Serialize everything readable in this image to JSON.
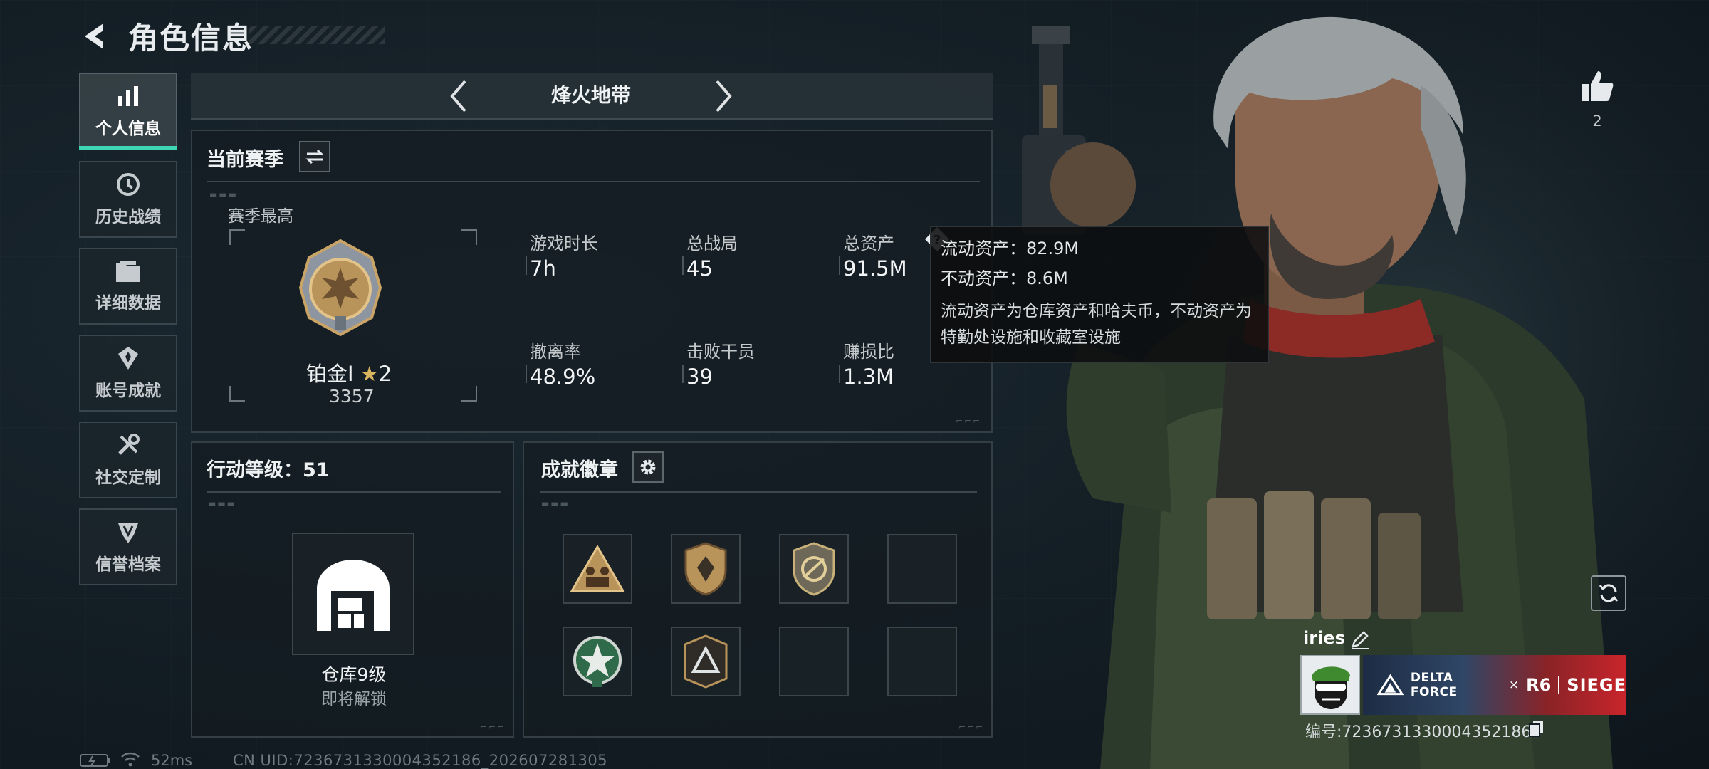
{
  "header": {
    "title": "角色信息"
  },
  "sidebar": {
    "items": [
      {
        "label": "个人信息",
        "icon": "bar-chart-icon",
        "active": true
      },
      {
        "label": "历史战绩",
        "icon": "history-icon"
      },
      {
        "label": "详细数据",
        "icon": "folder-icon"
      },
      {
        "label": "账号成就",
        "icon": "achievement-icon"
      },
      {
        "label": "社交定制",
        "icon": "tools-icon"
      },
      {
        "label": "信誉档案",
        "icon": "reputation-icon"
      }
    ]
  },
  "mode": {
    "name": "烽火地带"
  },
  "season": {
    "title": "当前赛季",
    "best_label": "赛季最高",
    "rank_name": "铂金I",
    "rank_stars": "2",
    "rank_score": "3357",
    "stats": [
      {
        "label": "游戏时长",
        "value": "7h"
      },
      {
        "label": "总战局",
        "value": "45"
      },
      {
        "label": "总资产",
        "value": "91.5M"
      },
      {
        "label": "撤离率",
        "value": "48.9%"
      },
      {
        "label": "击败干员",
        "value": "39"
      },
      {
        "label": "赚损比",
        "value": "1.3M"
      }
    ]
  },
  "tooltip": {
    "line1": "流动资产：82.9M",
    "line2": "不动资产：8.6M",
    "desc": "流动资产为仓库资产和哈夫币，不动资产为特勤处设施和收藏室设施"
  },
  "level": {
    "title": "行动等级：51",
    "warehouse_label": "仓库9级",
    "warehouse_sub": "即将解锁"
  },
  "badges": {
    "title": "成就徽章"
  },
  "player": {
    "name": "iries",
    "likes": "2",
    "uid_label": "编号:7236731330004352186",
    "banner_left": "DELTA FORCE",
    "banner_x": "×",
    "banner_r6": "R6",
    "banner_siege": "SIEGE"
  },
  "footer": {
    "ping": "52ms",
    "cn_uid": "CN UID:7236731330004352186_202607281305"
  },
  "colors": {
    "accent": "#3fd6b4",
    "banner_red": "#c8252b",
    "badge_gold": "#b8935a"
  }
}
